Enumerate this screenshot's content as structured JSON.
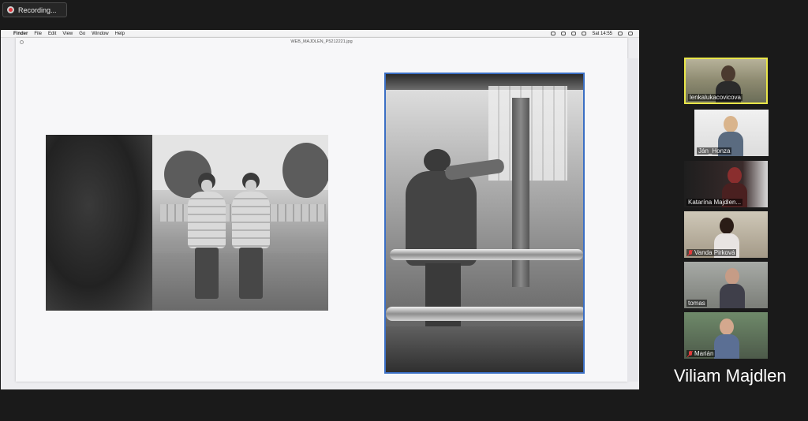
{
  "recording": {
    "label": "Recording..."
  },
  "menubar": {
    "apple": "",
    "items": [
      "Finder",
      "File",
      "Edit",
      "View",
      "Go",
      "Window",
      "Help"
    ],
    "clock": "Sat 14:55"
  },
  "viewer": {
    "filename": "WEB_MAJDLEN_P5212221.jpg"
  },
  "participants": [
    {
      "name": "lenkalukacovicova",
      "muted": false,
      "active": true
    },
    {
      "name": "Ján_Honza",
      "muted": false,
      "active": false
    },
    {
      "name": "Katarína Majdlen...",
      "muted": false,
      "active": false
    },
    {
      "name": "Vanda Pirková",
      "muted": true,
      "active": false
    },
    {
      "name": "tomas",
      "muted": false,
      "active": false
    },
    {
      "name": "Marián",
      "muted": true,
      "active": false
    }
  ],
  "active_speaker": "Viliam Majdlen",
  "colors": {
    "active_border": "#e9e649",
    "photo_border": "#3b6fc4",
    "mute_red": "#e23b3b"
  }
}
